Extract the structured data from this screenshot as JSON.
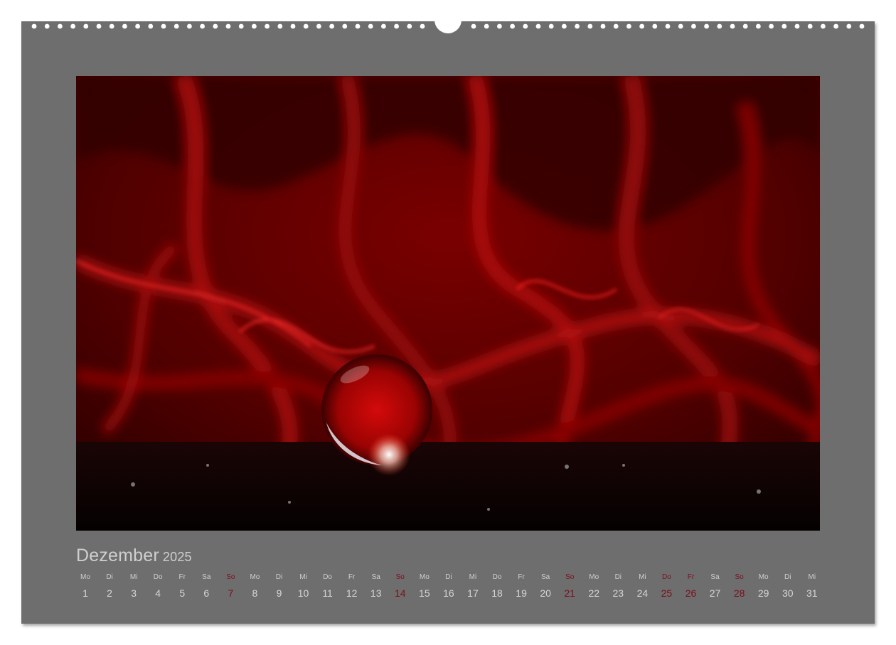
{
  "calendar": {
    "month": "Dezember",
    "year": "2025",
    "days": [
      {
        "name": "Mo",
        "num": "1",
        "red": false
      },
      {
        "name": "Di",
        "num": "2",
        "red": false
      },
      {
        "name": "Mi",
        "num": "3",
        "red": false
      },
      {
        "name": "Do",
        "num": "4",
        "red": false
      },
      {
        "name": "Fr",
        "num": "5",
        "red": false
      },
      {
        "name": "Sa",
        "num": "6",
        "red": false
      },
      {
        "name": "So",
        "num": "7",
        "red": true
      },
      {
        "name": "Mo",
        "num": "8",
        "red": false
      },
      {
        "name": "Di",
        "num": "9",
        "red": false
      },
      {
        "name": "Mi",
        "num": "10",
        "red": false
      },
      {
        "name": "Do",
        "num": "11",
        "red": false
      },
      {
        "name": "Fr",
        "num": "12",
        "red": false
      },
      {
        "name": "Sa",
        "num": "13",
        "red": false
      },
      {
        "name": "So",
        "num": "14",
        "red": true
      },
      {
        "name": "Mo",
        "num": "15",
        "red": false
      },
      {
        "name": "Di",
        "num": "16",
        "red": false
      },
      {
        "name": "Mi",
        "num": "17",
        "red": false
      },
      {
        "name": "Do",
        "num": "18",
        "red": false
      },
      {
        "name": "Fr",
        "num": "19",
        "red": false
      },
      {
        "name": "Sa",
        "num": "20",
        "red": false
      },
      {
        "name": "So",
        "num": "21",
        "red": true
      },
      {
        "name": "Mo",
        "num": "22",
        "red": false
      },
      {
        "name": "Di",
        "num": "23",
        "red": false
      },
      {
        "name": "Mi",
        "num": "24",
        "red": false
      },
      {
        "name": "Do",
        "num": "25",
        "red": true
      },
      {
        "name": "Fr",
        "num": "26",
        "red": true
      },
      {
        "name": "Sa",
        "num": "27",
        "red": false
      },
      {
        "name": "So",
        "num": "28",
        "red": true
      },
      {
        "name": "Mo",
        "num": "29",
        "red": false
      },
      {
        "name": "Di",
        "num": "30",
        "red": false
      },
      {
        "name": "Mi",
        "num": "31",
        "red": false
      }
    ]
  },
  "colors": {
    "sheet": "#6e6e6e",
    "text": "#cfcfcf",
    "holiday": "#7a0f1c",
    "silk": "#8a0000"
  }
}
